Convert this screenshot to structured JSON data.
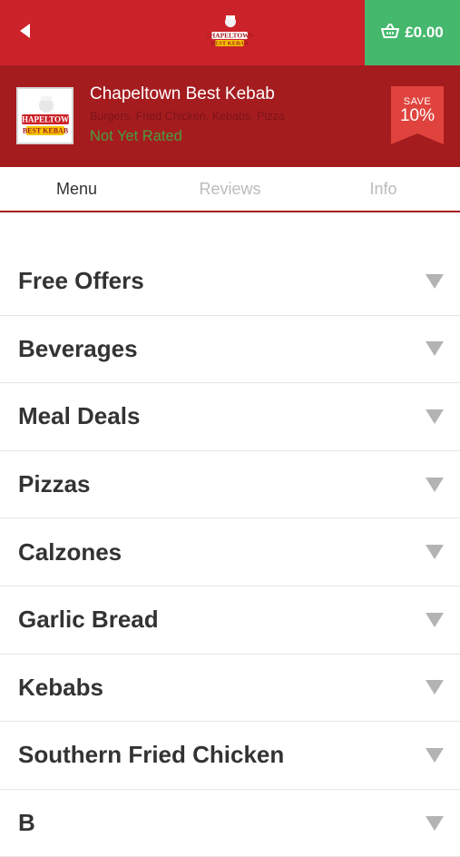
{
  "header": {
    "basket_total": "£0.00",
    "icons": {
      "back": "back-arrow-icon",
      "basket": "basket-icon",
      "logo": "chapeltown-logo"
    }
  },
  "restaurant": {
    "name": "Chapeltown Best Kebab",
    "cuisines": "Burgers, Fried Chicken, Kebabs, Pizza",
    "rating": "Not Yet Rated",
    "logo_text": [
      "CHAPELTOWN",
      "BEST KEBAB"
    ],
    "save_badge": {
      "small": "SAVE",
      "big": "10%"
    }
  },
  "tabs": [
    {
      "label": "Menu",
      "active": true
    },
    {
      "label": "Reviews",
      "active": false
    },
    {
      "label": "Info",
      "active": false
    }
  ],
  "menu": [
    {
      "label": "Free Offers"
    },
    {
      "label": "Beverages"
    },
    {
      "label": "Meal Deals"
    },
    {
      "label": "Pizzas"
    },
    {
      "label": "Calzones"
    },
    {
      "label": "Garlic Bread"
    },
    {
      "label": "Kebabs"
    },
    {
      "label": "Southern Fried Chicken"
    },
    {
      "label": "B"
    }
  ],
  "colors": {
    "topbar": "#cc2229",
    "restaurant_bg": "#a51c1f",
    "basket_bg": "#45b86e",
    "rating": "#4a9e3e",
    "badge": "#e0433d"
  }
}
